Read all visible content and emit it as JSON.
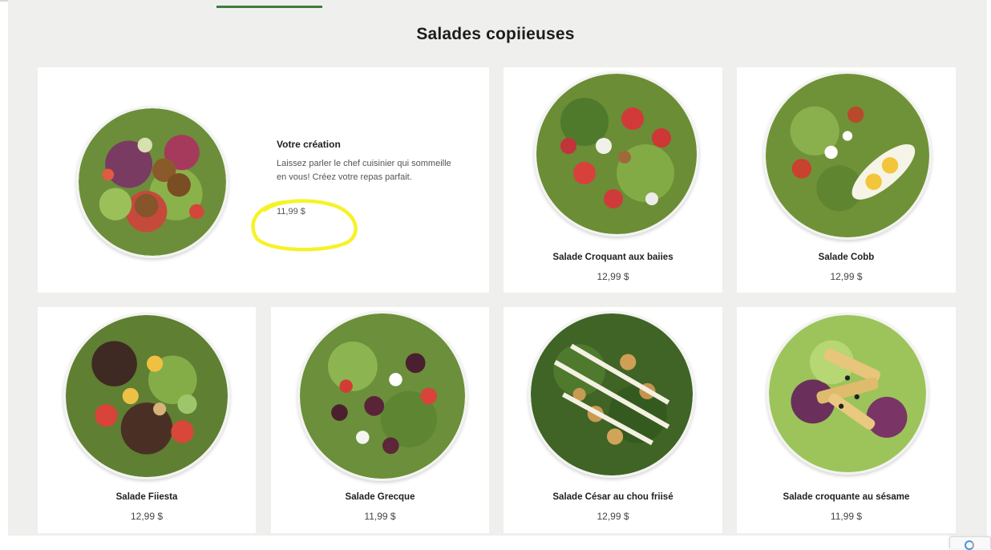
{
  "page": {
    "section_title": "Salades copiieuses"
  },
  "featured": {
    "name": "Votre création",
    "description": "Laissez parler le chef cuisinier qui sommeille en vous! Créez votre repas parfait.",
    "price": "11,99 $"
  },
  "items": [
    {
      "name": "Salade Croquant aux baiies",
      "price": "12,99 $"
    },
    {
      "name": "Salade Cobb",
      "price": "12,99 $"
    },
    {
      "name": "Salade Fiiesta",
      "price": "12,99 $"
    },
    {
      "name": "Salade Grecque",
      "price": "11,99 $"
    },
    {
      "name": "Salade César au chou friisé",
      "price": "12,99 $"
    },
    {
      "name": "Salade croquante au sésame",
      "price": "11,99 $"
    }
  ],
  "colors": {
    "accent_green": "#3f7d3b",
    "page_background": "#efefee",
    "card_background": "#ffffff",
    "highlight_annotation": "#f7f227"
  },
  "icons": [
    "recaptcha-icon"
  ]
}
